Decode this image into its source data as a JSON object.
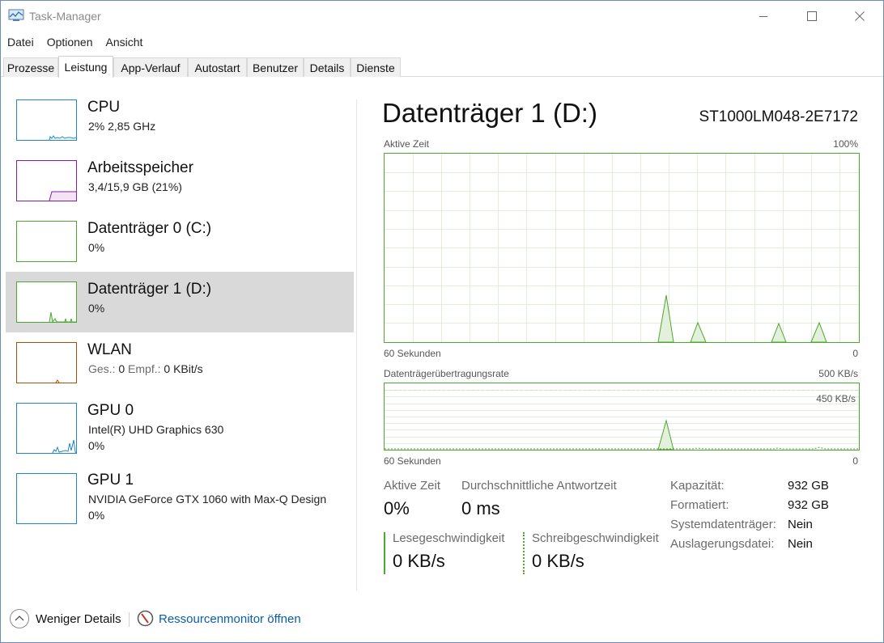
{
  "window": {
    "title": "Task-Manager"
  },
  "menu": [
    "Datei",
    "Optionen",
    "Ansicht"
  ],
  "tabs": [
    "Prozesse",
    "Leistung",
    "App-Verlauf",
    "Autostart",
    "Benutzer",
    "Details",
    "Dienste"
  ],
  "active_tab": "Leistung",
  "sidebar": {
    "items": [
      {
        "title": "CPU",
        "line1": "2%  2,85 GHz",
        "color": "#1e88c8"
      },
      {
        "title": "Arbeitsspeicher",
        "line1": "3,4/15,9 GB (21%)",
        "color": "#8a1e9c"
      },
      {
        "title": "Datenträger 0 (C:)",
        "line1": "0%",
        "color": "#4ea72e"
      },
      {
        "title": "Datenträger 1 (D:)",
        "line1": "0%",
        "color": "#4ea72e"
      },
      {
        "title": "WLAN",
        "line1_a": "Ges.:",
        "line1_b": "0",
        "line1_c": "Empf.:",
        "line1_d": "0 KBit/s",
        "color": "#a74e0c"
      },
      {
        "title": "GPU 0",
        "line1": "Intel(R) UHD Graphics 630",
        "line2": "0%",
        "color": "#1e88c8"
      },
      {
        "title": "GPU 1",
        "line1": "NVIDIA GeForce GTX 1060 with Max-Q Design",
        "line2": "0%",
        "color": "#1e88c8"
      }
    ],
    "selected_index": 3
  },
  "detail": {
    "title": "Datenträger 1 (D:)",
    "model": "ST1000LM048-2E7172",
    "graph1": {
      "label": "Aktive Zeit",
      "max_label": "100%",
      "time_label": "60 Sekunden",
      "min_label": "0"
    },
    "graph2": {
      "label": "Datenträgerübertragungsrate",
      "max_label": "500 KB/s",
      "inner_label": "450 KB/s",
      "time_label": "60 Sekunden",
      "min_label": "0"
    },
    "stats": {
      "active_time_label": "Aktive Zeit",
      "active_time_value": "0%",
      "response_label": "Durchschnittliche Antwortzeit",
      "response_value": "0 ms",
      "read_label": "Lesegeschwindigkeit",
      "read_value": "0 KB/s",
      "write_label": "Schreibgeschwindigkeit",
      "write_value": "0 KB/s"
    },
    "properties": [
      {
        "label": "Kapazität:",
        "value": "932 GB"
      },
      {
        "label": "Formatiert:",
        "value": "932 GB"
      },
      {
        "label": "Systemdatenträger:",
        "value": "Nein"
      },
      {
        "label": "Auslagerungsdatei:",
        "value": "Nein"
      }
    ]
  },
  "footer": {
    "less_details": "Weniger Details",
    "resource_monitor": "Ressourcenmonitor öffnen"
  },
  "colors": {
    "accent_green": "#4ea72e",
    "link": "#0a5ea8",
    "selected_bg": "#d9d9d9"
  }
}
